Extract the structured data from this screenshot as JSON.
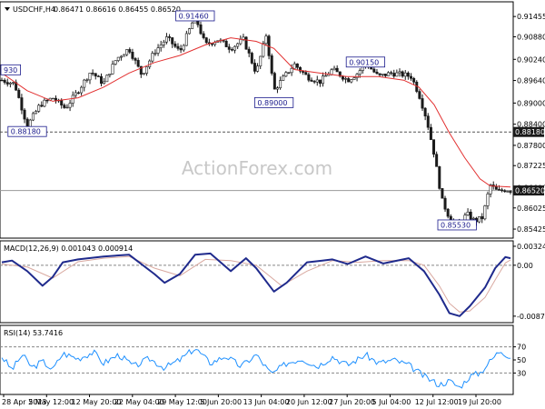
{
  "chart_data": [
    {
      "type": "candlestick",
      "header": {
        "symbol": "USDCHF,H4",
        "ohlc": "0.86471 0.86616 0.86455 0.86520"
      },
      "watermark": "ActionForex.com",
      "ylim": [
        0.8522,
        0.9182
      ],
      "y_ticks": [
        "0.91455",
        "0.90880",
        "0.90240",
        "0.89640",
        "0.89000",
        "0.88400",
        "0.87800",
        "0.87225",
        "0.86600",
        "0.86025",
        "0.85425"
      ],
      "y_tick_values": [
        0.91455,
        0.9088,
        0.9024,
        0.8964,
        0.89,
        0.884,
        0.878,
        0.87225,
        0.866,
        0.86025,
        0.85425
      ],
      "x_ticks": [
        "28 Apr 2023",
        "5 May 12:00",
        "12 May 20:00",
        "22 May 04:00",
        "29 May 12:00",
        "5 Jun 20:00",
        "13 Jun 04:00",
        "20 Jun 12:00",
        "27 Jun 20:00",
        "5 Jul 04:00",
        "12 Jul 12:00",
        "19 Jul 20:00"
      ],
      "price_tags": [
        {
          "text": "0.88180",
          "value": 0.8818,
          "style": "dark"
        },
        {
          "text": "0.86520",
          "value": 0.8652,
          "style": "dark"
        }
      ],
      "levels": [
        {
          "value": 0.8818,
          "style": "dashed"
        },
        {
          "value": 0.8652,
          "style": "solid"
        }
      ],
      "annotations": [
        {
          "text": "0.91460",
          "t": 0.38,
          "value": 0.9146
        },
        {
          "text": "0.90150",
          "t": 0.715,
          "value": 0.9015
        },
        {
          "text": "0.89000",
          "t": 0.535,
          "value": 0.89
        },
        {
          "text": "0.88180",
          "t": 0.05,
          "value": 0.8818
        },
        {
          "text": "0.85530",
          "t": 0.895,
          "value": 0.8553
        },
        {
          "text": "930",
          "t": 0.0,
          "value": 0.8993
        }
      ],
      "price_path": [
        [
          0.0,
          0.8965
        ],
        [
          0.025,
          0.8955
        ],
        [
          0.05,
          0.8835
        ],
        [
          0.075,
          0.8895
        ],
        [
          0.1,
          0.8915
        ],
        [
          0.125,
          0.8885
        ],
        [
          0.15,
          0.8935
        ],
        [
          0.175,
          0.899
        ],
        [
          0.2,
          0.8955
        ],
        [
          0.225,
          0.9025
        ],
        [
          0.25,
          0.9055
        ],
        [
          0.275,
          0.898
        ],
        [
          0.3,
          0.9045
        ],
        [
          0.325,
          0.9085
        ],
        [
          0.35,
          0.9045
        ],
        [
          0.38,
          0.9146
        ],
        [
          0.4,
          0.9065
        ],
        [
          0.425,
          0.908
        ],
        [
          0.45,
          0.9055
        ],
        [
          0.475,
          0.908
        ],
        [
          0.5,
          0.8985
        ],
        [
          0.52,
          0.9095
        ],
        [
          0.535,
          0.8935
        ],
        [
          0.55,
          0.8965
        ],
        [
          0.575,
          0.901
        ],
        [
          0.6,
          0.8975
        ],
        [
          0.625,
          0.896
        ],
        [
          0.65,
          0.8995
        ],
        [
          0.68,
          0.8965
        ],
        [
          0.7,
          0.8985
        ],
        [
          0.715,
          0.9015
        ],
        [
          0.74,
          0.8975
        ],
        [
          0.765,
          0.8985
        ],
        [
          0.79,
          0.898
        ],
        [
          0.805,
          0.8975
        ],
        [
          0.82,
          0.8925
        ],
        [
          0.835,
          0.8855
        ],
        [
          0.85,
          0.8755
        ],
        [
          0.865,
          0.8625
        ],
        [
          0.88,
          0.8575
        ],
        [
          0.895,
          0.8553
        ],
        [
          0.915,
          0.8585
        ],
        [
          0.93,
          0.8565
        ],
        [
          0.945,
          0.8575
        ],
        [
          0.96,
          0.8668
        ],
        [
          0.975,
          0.8648
        ],
        [
          0.99,
          0.8655
        ],
        [
          1.0,
          0.8652
        ]
      ],
      "ma_path": [
        [
          0.0,
          0.8985
        ],
        [
          0.05,
          0.8935
        ],
        [
          0.1,
          0.8905
        ],
        [
          0.15,
          0.8915
        ],
        [
          0.2,
          0.8945
        ],
        [
          0.25,
          0.8985
        ],
        [
          0.3,
          0.9015
        ],
        [
          0.35,
          0.9035
        ],
        [
          0.4,
          0.9065
        ],
        [
          0.45,
          0.9085
        ],
        [
          0.5,
          0.9075
        ],
        [
          0.535,
          0.9055
        ],
        [
          0.575,
          0.8995
        ],
        [
          0.625,
          0.8985
        ],
        [
          0.68,
          0.8975
        ],
        [
          0.74,
          0.8975
        ],
        [
          0.79,
          0.8965
        ],
        [
          0.82,
          0.8945
        ],
        [
          0.85,
          0.8895
        ],
        [
          0.88,
          0.8815
        ],
        [
          0.91,
          0.8745
        ],
        [
          0.94,
          0.8685
        ],
        [
          0.96,
          0.8665
        ],
        [
          1.0,
          0.8662
        ]
      ]
    },
    {
      "type": "line",
      "header": "MACD(12,26,9) 0.001043 0.000914",
      "ylim": [
        -0.0095,
        0.0037
      ],
      "y_ticks": [
        "0.003242",
        "0.00",
        "-0.008703"
      ],
      "y_tick_values": [
        0.003242,
        0.0,
        -0.008703
      ],
      "zero_line": 0.0,
      "macd": [
        [
          0.0,
          0.0005
        ],
        [
          0.02,
          0.0008
        ],
        [
          0.05,
          -0.001
        ],
        [
          0.08,
          -0.0035
        ],
        [
          0.1,
          -0.002
        ],
        [
          0.12,
          0.0005
        ],
        [
          0.15,
          0.001
        ],
        [
          0.2,
          0.0015
        ],
        [
          0.25,
          0.0018
        ],
        [
          0.3,
          -0.0015
        ],
        [
          0.32,
          -0.003
        ],
        [
          0.35,
          -0.0015
        ],
        [
          0.38,
          0.0018
        ],
        [
          0.41,
          0.002
        ],
        [
          0.45,
          -0.001
        ],
        [
          0.48,
          0.0012
        ],
        [
          0.5,
          -0.0005
        ],
        [
          0.535,
          -0.0045
        ],
        [
          0.56,
          -0.003
        ],
        [
          0.6,
          0.0005
        ],
        [
          0.63,
          0.0008
        ],
        [
          0.65,
          0.001
        ],
        [
          0.68,
          0.0002
        ],
        [
          0.715,
          0.0015
        ],
        [
          0.75,
          0.0003
        ],
        [
          0.8,
          0.0012
        ],
        [
          0.83,
          -0.001
        ],
        [
          0.86,
          -0.005
        ],
        [
          0.88,
          -0.0082
        ],
        [
          0.9,
          -0.0087
        ],
        [
          0.92,
          -0.007
        ],
        [
          0.95,
          -0.0038
        ],
        [
          0.97,
          -0.0005
        ],
        [
          0.99,
          0.0014
        ],
        [
          1.0,
          0.0012
        ]
      ],
      "signal": [
        [
          0.0,
          0.0002
        ],
        [
          0.05,
          -0.0003
        ],
        [
          0.1,
          -0.0022
        ],
        [
          0.15,
          0.0006
        ],
        [
          0.2,
          0.0012
        ],
        [
          0.25,
          0.0015
        ],
        [
          0.3,
          -0.0005
        ],
        [
          0.35,
          -0.0018
        ],
        [
          0.4,
          0.001
        ],
        [
          0.45,
          0.0008
        ],
        [
          0.5,
          0.0
        ],
        [
          0.55,
          -0.0035
        ],
        [
          0.6,
          -0.001
        ],
        [
          0.65,
          0.0008
        ],
        [
          0.7,
          0.0005
        ],
        [
          0.75,
          0.0008
        ],
        [
          0.8,
          0.0008
        ],
        [
          0.83,
          0.0
        ],
        [
          0.86,
          -0.0035
        ],
        [
          0.88,
          -0.0065
        ],
        [
          0.9,
          -0.008
        ],
        [
          0.92,
          -0.0078
        ],
        [
          0.95,
          -0.0055
        ],
        [
          0.97,
          -0.0025
        ],
        [
          0.99,
          0.0004
        ],
        [
          1.0,
          0.0009
        ]
      ]
    },
    {
      "type": "line",
      "header": "RSI(14) 53.7416",
      "ylim": [
        0,
        100
      ],
      "y_ticks": [
        "70",
        "50",
        "30"
      ],
      "y_tick_values": [
        70,
        50,
        30
      ],
      "levels": [
        70,
        30
      ],
      "rsi": [
        [
          0.0,
          55
        ],
        [
          0.02,
          35
        ],
        [
          0.04,
          58
        ],
        [
          0.06,
          38
        ],
        [
          0.08,
          48
        ],
        [
          0.1,
          35
        ],
        [
          0.12,
          60
        ],
        [
          0.15,
          52
        ],
        [
          0.18,
          62
        ],
        [
          0.2,
          45
        ],
        [
          0.23,
          58
        ],
        [
          0.26,
          40
        ],
        [
          0.29,
          52
        ],
        [
          0.32,
          38
        ],
        [
          0.35,
          50
        ],
        [
          0.38,
          68
        ],
        [
          0.41,
          45
        ],
        [
          0.44,
          56
        ],
        [
          0.47,
          40
        ],
        [
          0.5,
          58
        ],
        [
          0.53,
          28
        ],
        [
          0.56,
          45
        ],
        [
          0.59,
          52
        ],
        [
          0.62,
          40
        ],
        [
          0.65,
          55
        ],
        [
          0.68,
          42
        ],
        [
          0.715,
          58
        ],
        [
          0.74,
          45
        ],
        [
          0.77,
          50
        ],
        [
          0.8,
          42
        ],
        [
          0.83,
          25
        ],
        [
          0.86,
          12
        ],
        [
          0.88,
          18
        ],
        [
          0.9,
          8
        ],
        [
          0.92,
          25
        ],
        [
          0.94,
          30
        ],
        [
          0.96,
          48
        ],
        [
          0.98,
          65
        ],
        [
          1.0,
          54
        ]
      ]
    }
  ]
}
